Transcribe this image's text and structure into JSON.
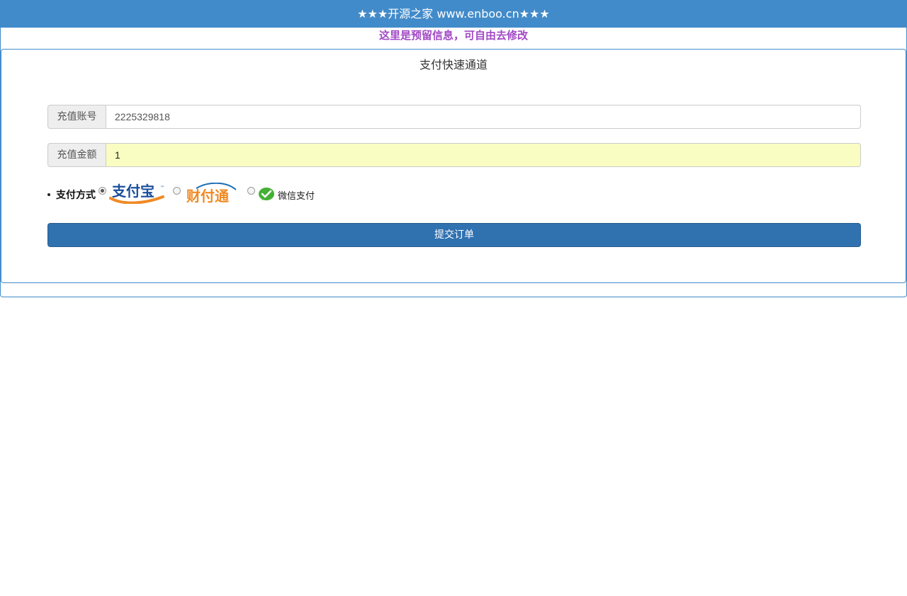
{
  "header": {
    "title": "★★★开源之家 www.enboo.cn★★★"
  },
  "notice": {
    "text": "这里是预留信息，可自由去修改"
  },
  "panel": {
    "title": "支付快速通道"
  },
  "form": {
    "account": {
      "label": "充值账号",
      "value": "2225329818"
    },
    "amount": {
      "label": "充值金额",
      "value": "1"
    },
    "payment": {
      "label": "支付方式",
      "options": [
        {
          "name": "支付宝",
          "selected": true
        },
        {
          "name": "财付通",
          "selected": false
        },
        {
          "name": "微信支付",
          "selected": false
        }
      ]
    },
    "submit_label": "提交订单"
  },
  "colors": {
    "primary": "#428bca",
    "button": "#3071b0",
    "notice": "#a249c5",
    "amount_bg": "#fafdc1"
  }
}
